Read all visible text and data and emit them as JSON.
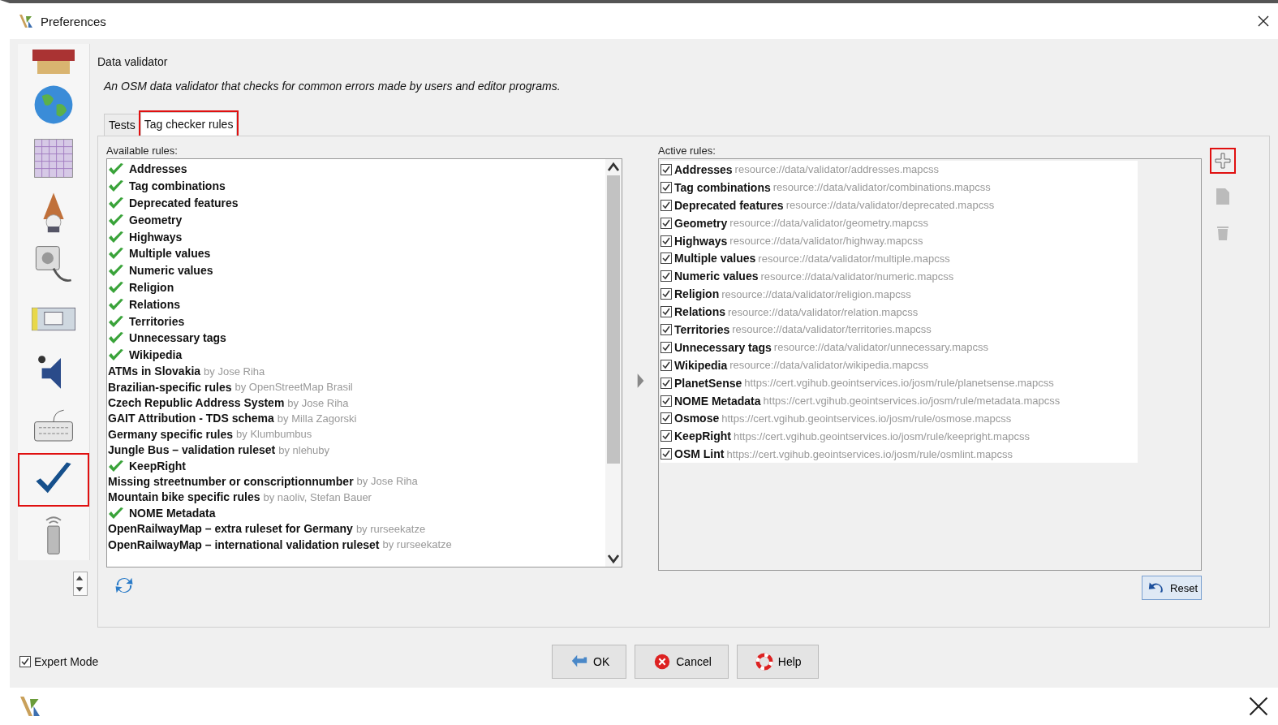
{
  "window": {
    "title": "Preferences"
  },
  "sidebar": {
    "items": [
      {
        "kind": "toolbar",
        "highlighted": false
      },
      {
        "kind": "globe",
        "highlighted": false
      },
      {
        "kind": "grid",
        "highlighted": false
      },
      {
        "kind": "wizard",
        "highlighted": false
      },
      {
        "kind": "plug",
        "highlighted": false
      },
      {
        "kind": "display",
        "highlighted": false
      },
      {
        "kind": "audio",
        "highlighted": false
      },
      {
        "kind": "keyboard",
        "highlighted": false
      },
      {
        "kind": "validator",
        "highlighted": true
      },
      {
        "kind": "remote",
        "highlighted": false
      }
    ]
  },
  "panel": {
    "title": "Data validator",
    "description": "An OSM data validator that checks for common errors made by users and editor programs."
  },
  "tabs": [
    {
      "label": "Tests",
      "selected": false,
      "highlighted": false
    },
    {
      "label": "Tag checker rules",
      "selected": true,
      "highlighted": true
    }
  ],
  "available": {
    "label": "Available rules:",
    "items": [
      {
        "name": "Addresses",
        "installed": true
      },
      {
        "name": "Tag combinations",
        "installed": true
      },
      {
        "name": "Deprecated features",
        "installed": true
      },
      {
        "name": "Geometry",
        "installed": true
      },
      {
        "name": "Highways",
        "installed": true
      },
      {
        "name": "Multiple values",
        "installed": true
      },
      {
        "name": "Numeric values",
        "installed": true
      },
      {
        "name": "Religion",
        "installed": true
      },
      {
        "name": "Relations",
        "installed": true
      },
      {
        "name": "Territories",
        "installed": true
      },
      {
        "name": "Unnecessary tags",
        "installed": true
      },
      {
        "name": "Wikipedia",
        "installed": true
      },
      {
        "name": "ATMs in Slovakia",
        "author": "by Jose Riha",
        "installed": false
      },
      {
        "name": "Brazilian-specific rules",
        "author": "by OpenStreetMap Brasil",
        "installed": false
      },
      {
        "name": "Czech Republic Address System",
        "author": "by Jose Riha",
        "installed": false
      },
      {
        "name": "GAIT Attribution - TDS schema",
        "author": "by Milla Zagorski",
        "installed": false
      },
      {
        "name": "Germany specific rules",
        "author": "by Klumbumbus",
        "installed": false
      },
      {
        "name": "Jungle Bus – validation ruleset",
        "author": "by nlehuby",
        "installed": false
      },
      {
        "name": "KeepRight",
        "installed": true
      },
      {
        "name": "Missing streetnumber or conscriptionnumber",
        "author": "by Jose Riha",
        "installed": false
      },
      {
        "name": "Mountain bike specific rules",
        "author": "by naoliv, Stefan Bauer",
        "installed": false
      },
      {
        "name": "NOME Metadata",
        "installed": true
      },
      {
        "name": "OpenRailwayMap – extra ruleset for Germany",
        "author": "by rurseekatze",
        "installed": false
      },
      {
        "name": "OpenRailwayMap – international validation ruleset",
        "author": "by rurseekatze",
        "installed": false
      }
    ]
  },
  "active": {
    "label": "Active rules:",
    "items": [
      {
        "name": "Addresses",
        "source": "resource://data/validator/addresses.mapcss",
        "checked": true
      },
      {
        "name": "Tag combinations",
        "source": "resource://data/validator/combinations.mapcss",
        "checked": true
      },
      {
        "name": "Deprecated features",
        "source": "resource://data/validator/deprecated.mapcss",
        "checked": true
      },
      {
        "name": "Geometry",
        "source": "resource://data/validator/geometry.mapcss",
        "checked": true
      },
      {
        "name": "Highways",
        "source": "resource://data/validator/highway.mapcss",
        "checked": true
      },
      {
        "name": "Multiple values",
        "source": "resource://data/validator/multiple.mapcss",
        "checked": true
      },
      {
        "name": "Numeric values",
        "source": "resource://data/validator/numeric.mapcss",
        "checked": true
      },
      {
        "name": "Religion",
        "source": "resource://data/validator/religion.mapcss",
        "checked": true
      },
      {
        "name": "Relations",
        "source": "resource://data/validator/relation.mapcss",
        "checked": true
      },
      {
        "name": "Territories",
        "source": "resource://data/validator/territories.mapcss",
        "checked": true
      },
      {
        "name": "Unnecessary tags",
        "source": "resource://data/validator/unnecessary.mapcss",
        "checked": true
      },
      {
        "name": "Wikipedia",
        "source": "resource://data/validator/wikipedia.mapcss",
        "checked": true
      },
      {
        "name": "PlanetSense",
        "source": "https://cert.vgihub.geointservices.io/josm/rule/planetsense.mapcss",
        "checked": true
      },
      {
        "name": "NOME Metadata",
        "source": "https://cert.vgihub.geointservices.io/josm/rule/metadata.mapcss",
        "checked": true
      },
      {
        "name": "Osmose",
        "source": "https://cert.vgihub.geointservices.io/josm/rule/osmose.mapcss",
        "checked": true
      },
      {
        "name": "KeepRight",
        "source": "https://cert.vgihub.geointservices.io/josm/rule/keepright.mapcss",
        "checked": true
      },
      {
        "name": "OSM Lint",
        "source": "https://cert.vgihub.geointservices.io/josm/rule/osmlint.mapcss",
        "checked": true
      }
    ]
  },
  "side_tools": [
    {
      "kind": "add",
      "highlighted": true
    },
    {
      "kind": "edit",
      "highlighted": false
    },
    {
      "kind": "delete",
      "highlighted": false
    }
  ],
  "reset_button": {
    "label": "Reset"
  },
  "expert_mode": {
    "label": "Expert Mode",
    "checked": true
  },
  "buttons": [
    {
      "kind": "ok",
      "label": "OK"
    },
    {
      "kind": "cancel",
      "label": "Cancel"
    },
    {
      "kind": "help",
      "label": "Help"
    }
  ]
}
